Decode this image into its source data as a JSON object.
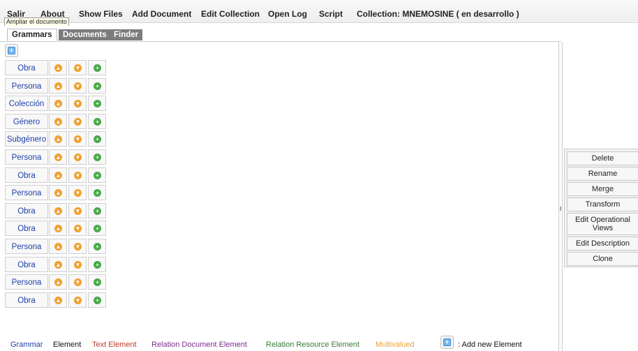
{
  "menu": {
    "salir": "Salir",
    "about": "About",
    "show_files": "Show Files",
    "add_document": "Add Document",
    "edit_collection": "Edit Collection",
    "open_log": "Open Log",
    "script": "Script",
    "collection": "Collection: MNEMOSINE ( en desarrollo )"
  },
  "tooltip": "Ampliar el documento",
  "tabs": [
    "Grammars",
    "Documents",
    "Finder"
  ],
  "add_icon": "plus-square-icon",
  "grammars": [
    "Obra",
    "Persona",
    "Colección",
    "Género",
    "Subgénero",
    "Persona",
    "Obra",
    "Persona",
    "Obra",
    "Obra",
    "Persona",
    "Obra",
    "Persona",
    "Obra"
  ],
  "row_icons": {
    "up": "arrow-up-circle-icon",
    "down": "arrow-down-circle-icon",
    "add": "plus-circle-icon"
  },
  "actions": [
    "Delete",
    "Rename",
    "Merge",
    "Transform",
    "Edit Operational Views",
    "Edit Description",
    "Clone"
  ],
  "legend": {
    "grammar": "Grammar",
    "element": "Element",
    "text_element": "Text Element",
    "relation_document": "Relation Document Element",
    "relation_resource": "Relation Resource Element",
    "multivalued": "Multivalued",
    "add_new": ": Add new Element"
  },
  "colors": {
    "grammar": "#1f3fa8",
    "element": "#111111",
    "text_element": "#c0392b",
    "relation_document": "#7b2f8f",
    "relation_resource": "#3a7a3a",
    "multivalued": "#e8a23a"
  }
}
